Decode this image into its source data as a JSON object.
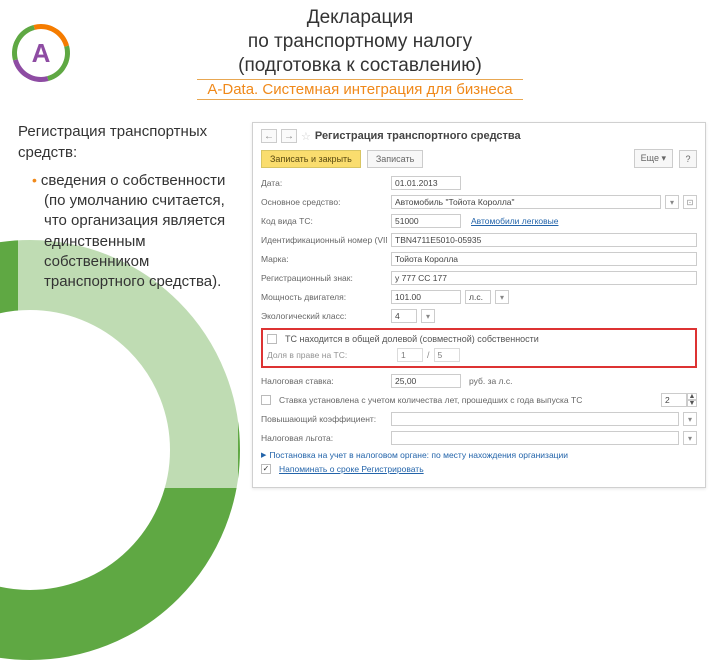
{
  "heading_line1": "Декларация",
  "heading_line2": "по транспортному налогу",
  "heading_line3": "(подготовка к составлению)",
  "subheading": "A-Data. Системная интеграция для бизнеса",
  "logo_letter": "A",
  "left": {
    "title": "Регистрация транспортных средств:",
    "bullet1": "сведения о собственности (по умолчанию считается, что организация является единственным собственником транспортного средства)."
  },
  "app": {
    "nav_back": "←",
    "nav_fwd": "→",
    "star": "☆",
    "title": "Регистрация транспортного средства",
    "save_close": "Записать и закрыть",
    "save": "Записать",
    "more": "Еще ▾",
    "help": "?",
    "fields": {
      "date_label": "Дата:",
      "date_value": "01.01.2013",
      "os_label": "Основное средство:",
      "os_value": "Автомобиль \"Тойота Королла\"",
      "code_label": "Код вида ТС:",
      "code_value": "51000",
      "code_link": "Автомобили легковые",
      "vin_label": "Идентификационный номер (VIN):",
      "vin_value": "TBN4711E5010-05935",
      "make_label": "Марка:",
      "make_value": "Тойота Королла",
      "reg_label": "Регистрационный знак:",
      "reg_value": "у 777 СС 177",
      "power_label": "Мощность двигателя:",
      "power_value": "101.00",
      "power_unit": "л.с.",
      "eco_label": "Экологический класс:",
      "eco_value": "4",
      "shared_label": "ТС находится в общей долевой (совместной) собственности",
      "share_label": "Доля в праве на ТС:",
      "share_a": "1",
      "share_sep": "/",
      "share_b": "5",
      "tax_label": "Налоговая ставка:",
      "tax_value": "25,00",
      "tax_unit": "руб. за л.с.",
      "rate_coeff_label": "Ставка установлена с учетом количества лет, прошедших с года выпуска ТС",
      "rate_coeff_value": "2",
      "raise_label": "Повышающий коэффициент:",
      "benefit_label": "Налоговая льгота:",
      "reg_in": "Постановка на учет в налоговом органе: по месту нахождения организации",
      "remind": "Напоминать о сроке Регистрировать"
    }
  }
}
